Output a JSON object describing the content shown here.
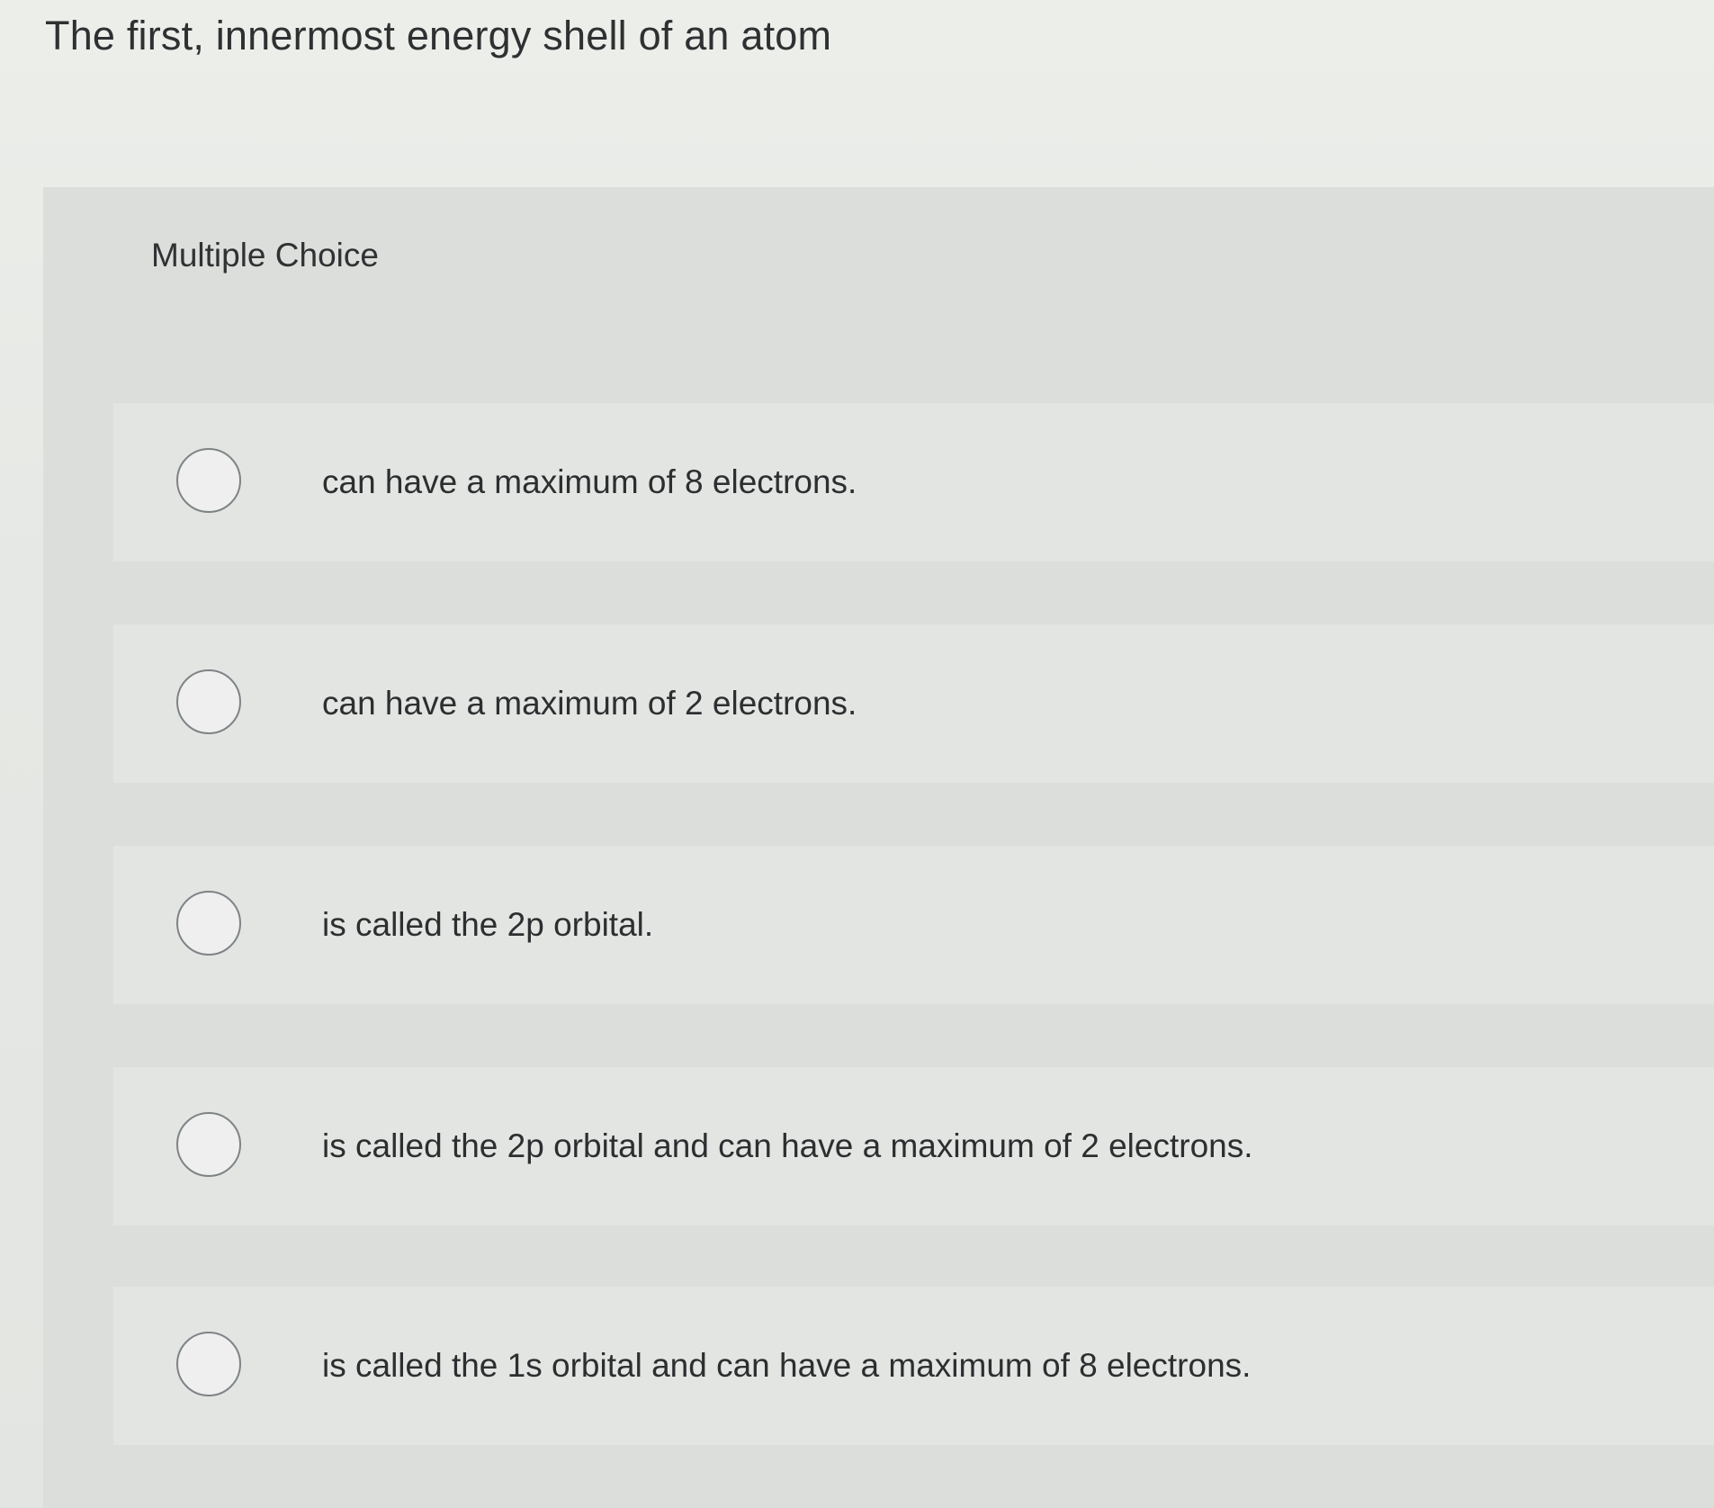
{
  "question": {
    "text": "The first, innermost energy shell of an atom"
  },
  "panel": {
    "label": "Multiple Choice"
  },
  "options": [
    {
      "text": "can have a maximum of 8 electrons.",
      "selected": false
    },
    {
      "text": "can have a maximum of 2 electrons.",
      "selected": false
    },
    {
      "text": "is called the 2p orbital.",
      "selected": false
    },
    {
      "text": "is called the 2p orbital and can have a maximum of 2 electrons.",
      "selected": false
    },
    {
      "text": "is called the 1s orbital and can have a maximum of 8 electrons.",
      "selected": false
    }
  ]
}
